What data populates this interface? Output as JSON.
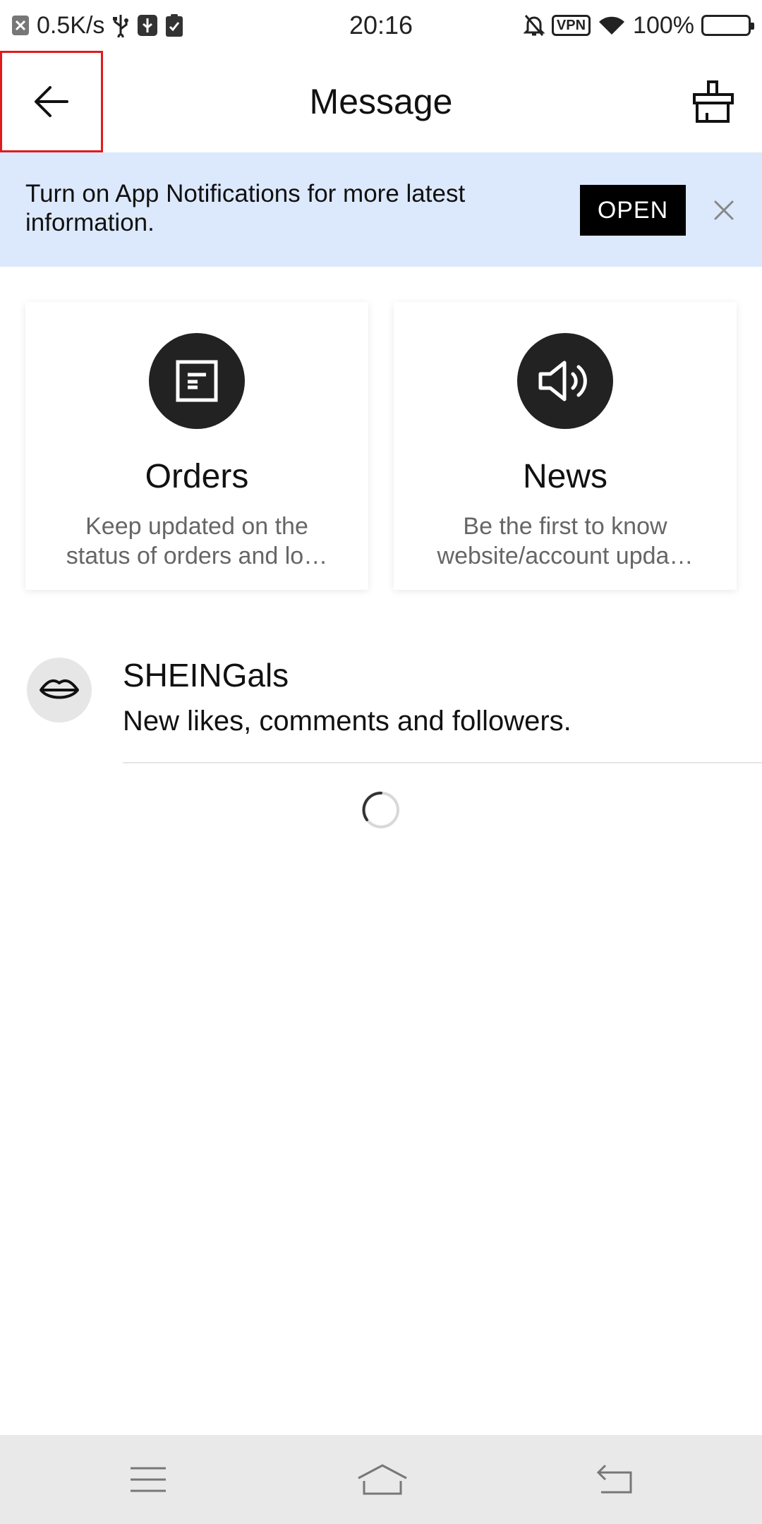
{
  "status_bar": {
    "net_speed": "0.5K/s",
    "time": "20:16",
    "vpn": "VPN",
    "battery": "100%"
  },
  "header": {
    "title": "Message",
    "back_icon": "arrow-left-icon",
    "clean_icon": "brush-icon"
  },
  "banner": {
    "text": "Turn on App Notifications for more latest information.",
    "button": "OPEN",
    "close_icon": "close-icon",
    "background": "#dce9fc"
  },
  "cards": [
    {
      "title": "Orders",
      "desc_line1": "Keep updated on the",
      "desc_line2": "status of orders and lo…",
      "icon": "document-icon"
    },
    {
      "title": "News",
      "desc_line1": "Be the first to know",
      "desc_line2": "website/account upda…",
      "icon": "speaker-icon"
    }
  ],
  "sheingals": {
    "title": "SHEINGals",
    "subtitle": "New likes, comments and followers.",
    "icon": "lips-icon"
  },
  "navbar": {
    "items": [
      "menu-icon",
      "home-icon",
      "back-icon"
    ]
  }
}
